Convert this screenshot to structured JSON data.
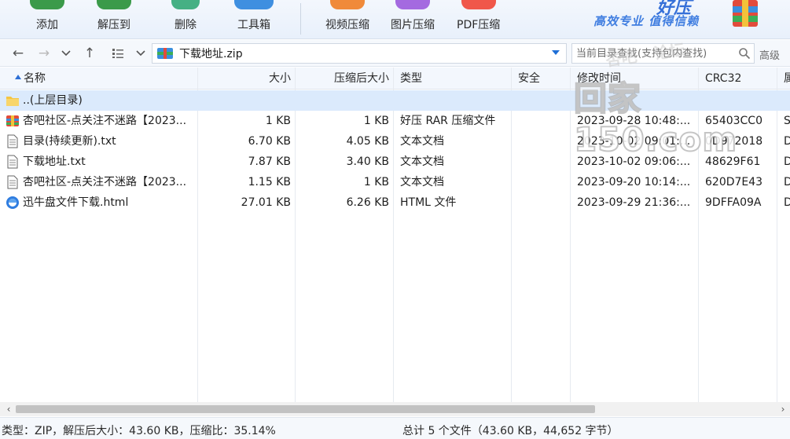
{
  "toolbar": {
    "buttons": [
      {
        "label": "添加",
        "icon": "add-icon",
        "color": "#3b9a4a"
      },
      {
        "label": "解压到",
        "icon": "extract-icon",
        "color": "#3b9a4a"
      },
      {
        "label": "删除",
        "icon": "delete-icon",
        "color": "#45b084"
      },
      {
        "label": "工具箱",
        "icon": "toolbox-icon",
        "color": "#3f8fe0"
      },
      {
        "label": "视频压缩",
        "icon": "video-compress-icon",
        "color": "#f08a3a"
      },
      {
        "label": "图片压缩",
        "icon": "image-compress-icon",
        "color": "#a46ae0"
      },
      {
        "label": "PDF压缩",
        "icon": "pdf-compress-icon",
        "color": "#f0574a"
      }
    ],
    "brand_name": "好压",
    "brand_slogan": "高效专业 值得信赖"
  },
  "address": {
    "path": "下载地址.zip",
    "search_placeholder": "当前目录查找(支持包内查找)",
    "advanced_label": "高级"
  },
  "watermark": {
    "small": "杏吧 · 论坛",
    "big": "回家150.com"
  },
  "columns": {
    "name": "名称",
    "size": "大小",
    "packed": "压缩后大小",
    "type": "类型",
    "security": "安全",
    "modified": "修改时间",
    "crc": "CRC32",
    "attr": "属"
  },
  "files": [
    {
      "name": "..(上层目录)",
      "size": "",
      "packed": "",
      "type": "",
      "security": "",
      "modified": "",
      "crc": "",
      "attr": "",
      "icon": "folder-icon"
    },
    {
      "name": "杏吧社区-点关注不迷路【2023...",
      "size": "1 KB",
      "packed": "1 KB",
      "type": "好压 RAR 压缩文件",
      "security": "",
      "modified": "2023-09-28 10:48:...",
      "crc": "65403CC0",
      "attr": "S",
      "icon": "rar-archive-icon"
    },
    {
      "name": "目录(持续更新).txt",
      "size": "6.70 KB",
      "packed": "4.05 KB",
      "type": "文本文档",
      "security": "",
      "modified": "2023-10-02 09:01:...",
      "crc": "0D972018",
      "attr": "D",
      "icon": "text-file-icon"
    },
    {
      "name": "下载地址.txt",
      "size": "7.87 KB",
      "packed": "3.40 KB",
      "type": "文本文档",
      "security": "",
      "modified": "2023-10-02 09:06:...",
      "crc": "48629F61",
      "attr": "D",
      "icon": "text-file-icon"
    },
    {
      "name": "杏吧社区-点关注不迷路【2023...",
      "size": "1.15 KB",
      "packed": "1 KB",
      "type": "文本文档",
      "security": "",
      "modified": "2023-09-20 10:14:...",
      "crc": "620D7E43",
      "attr": "D",
      "icon": "text-file-icon"
    },
    {
      "name": "迅牛盘文件下载.html",
      "size": "27.01 KB",
      "packed": "6.26 KB",
      "type": "HTML 文件",
      "security": "",
      "modified": "2023-09-29 21:36:...",
      "crc": "9DFFA09A",
      "attr": "D",
      "icon": "html-file-icon"
    }
  ],
  "status": {
    "left": "类型：ZIP，解压后大小：43.60 KB，压缩比：35.14%",
    "center": "总计 5 个文件（43.60 KB，44,652 字节）"
  }
}
